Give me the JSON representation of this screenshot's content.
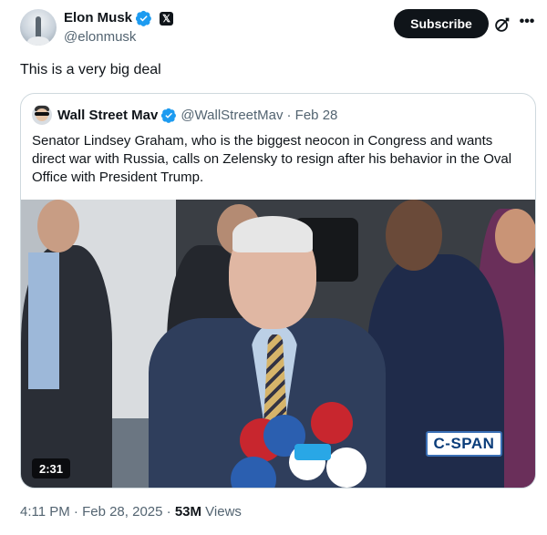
{
  "post": {
    "author_name": "Elon Musk",
    "author_handle": "@elonmusk",
    "subscribe_label": "Subscribe",
    "more_label": "•••",
    "text": "This is a very big deal",
    "timestamp": "4:11 PM · Feb 28, 2025 · ",
    "views_count": "53M",
    "views_label": " Views"
  },
  "quoted": {
    "author_name": "Wall Street Mav",
    "author_handle": "@WallStreetMav",
    "date": "· Feb 28",
    "text": "Senator Lindsey Graham, who is the biggest neocon in Congress and wants direct war with Russia, calls on Zelensky to resign after his behavior in the Oval Office with President Trump.",
    "video": {
      "duration": "2:31",
      "watermark": "C-SPAN"
    }
  },
  "icons": {
    "verified": "verified-badge-icon",
    "x_affiliate": "x-logo-icon",
    "grok": "grok-icon",
    "more": "more-icon"
  },
  "colors": {
    "verified_blue": "#1d9bf0",
    "subscribe_bg": "#0f1419",
    "secondary_text": "#536471",
    "border": "#cfd9de"
  }
}
